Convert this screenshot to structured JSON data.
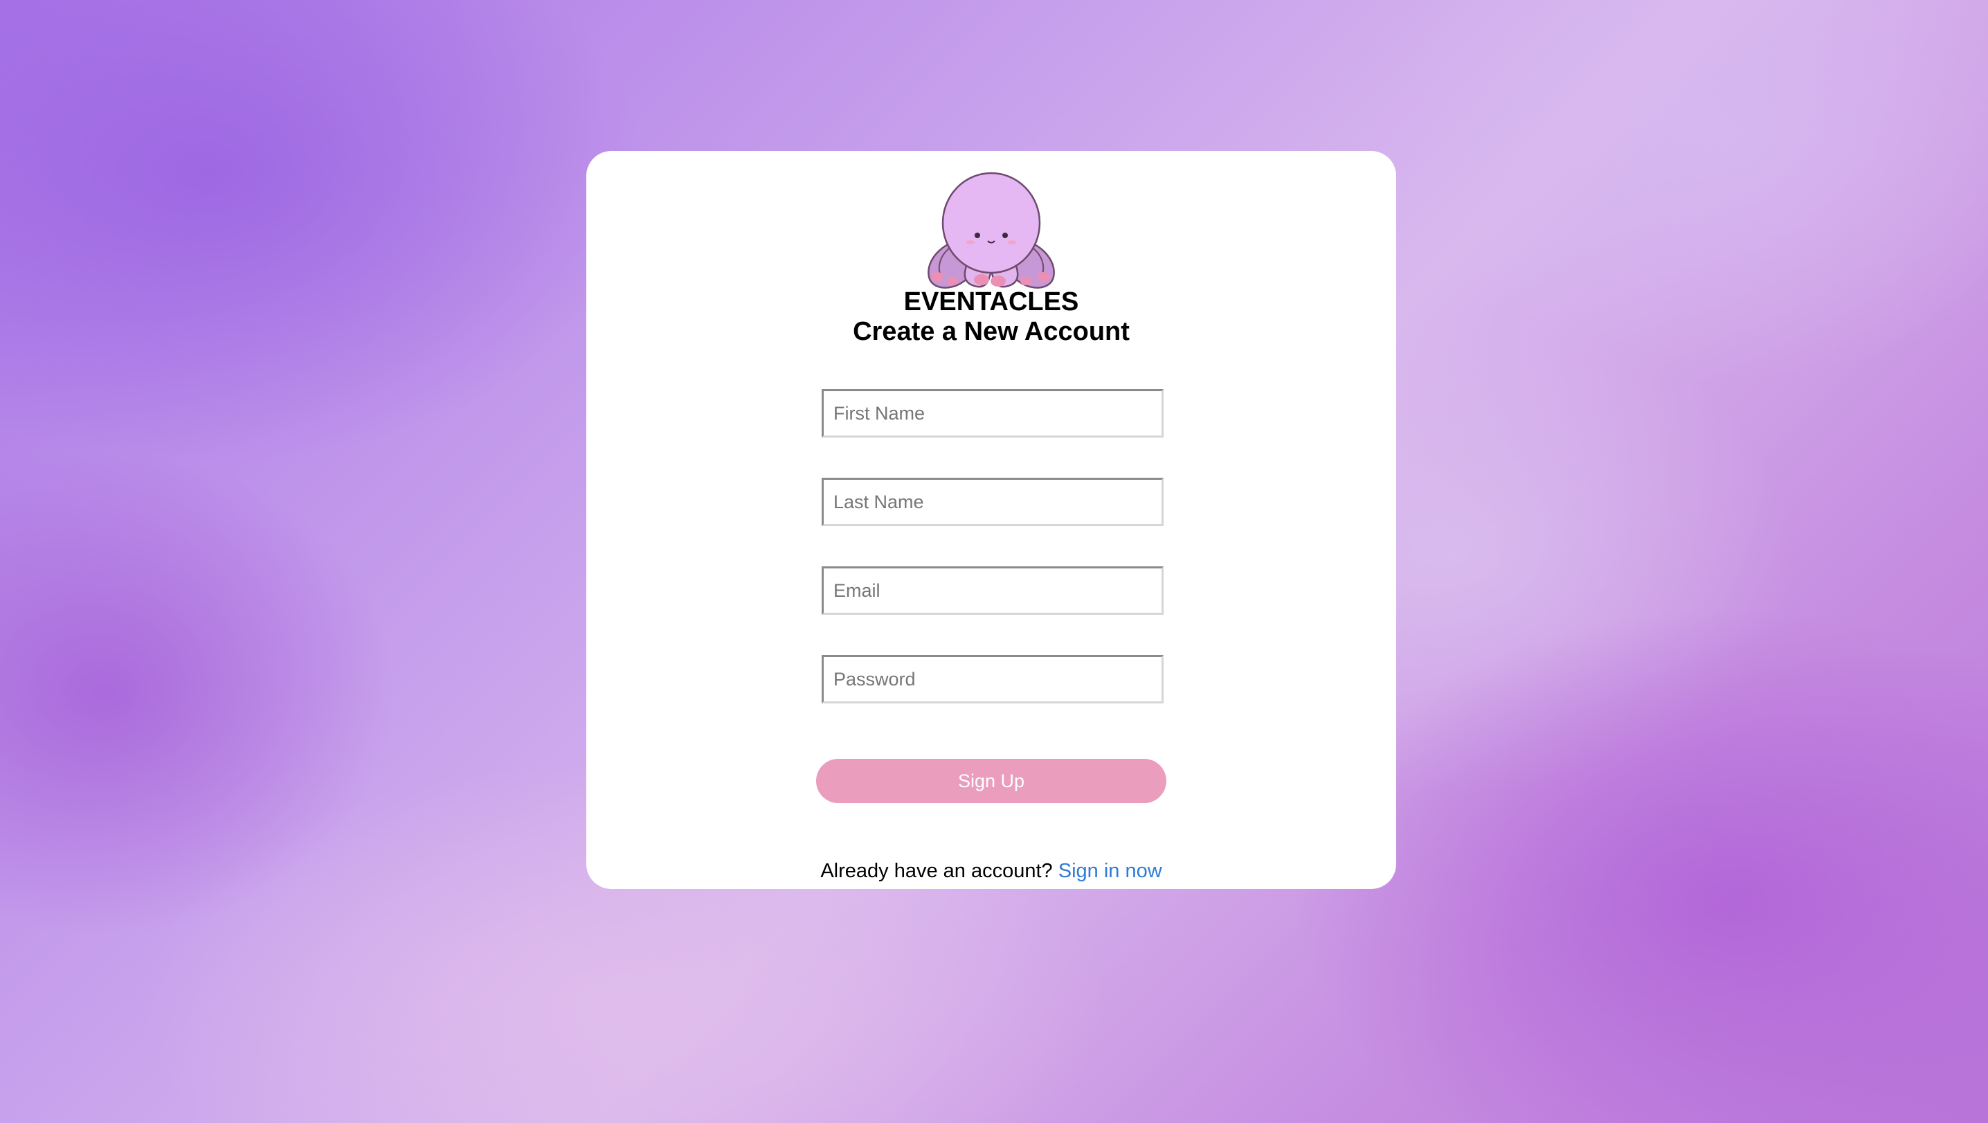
{
  "brand": {
    "logo_icon": "octopus-icon",
    "name": "EVENTACLES"
  },
  "form": {
    "heading": "Create a New Account",
    "first_name_placeholder": "First Name",
    "last_name_placeholder": "Last Name",
    "email_placeholder": "Email",
    "password_placeholder": "Password",
    "submit_label": "Sign Up",
    "submit_color": "#ea9dbd"
  },
  "footer": {
    "prompt": "Already have an account?",
    "link_label": "Sign in now",
    "link_color": "#2f7bd6"
  }
}
